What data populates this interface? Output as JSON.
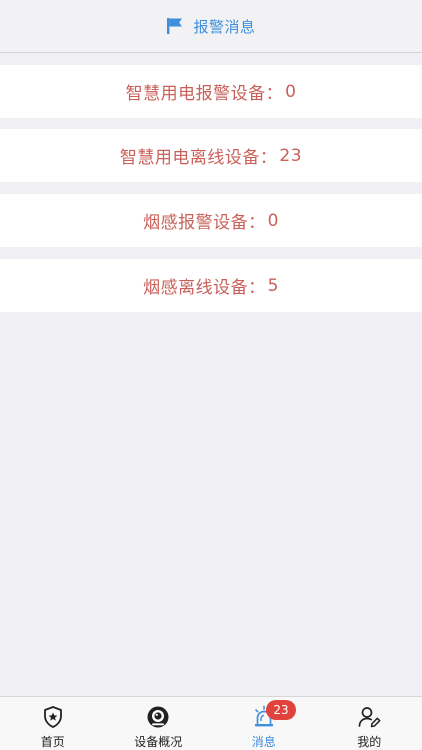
{
  "header": {
    "title": "报警消息",
    "icon": "flag-icon",
    "color": "#3f8fdc"
  },
  "cards": [
    {
      "label": "智慧用电报警设备：",
      "value": "0"
    },
    {
      "label": "智慧用电离线设备：",
      "value": "23"
    },
    {
      "label": "烟感报警设备：",
      "value": "0"
    },
    {
      "label": "烟感离线设备：",
      "value": "5"
    }
  ],
  "tabbar": {
    "tabs": [
      {
        "label": "首页",
        "icon": "shield-star-icon"
      },
      {
        "label": "设备概况",
        "icon": "camera-lens-icon"
      },
      {
        "label": "消息",
        "icon": "alarm-light-icon",
        "badge": "23",
        "active": true
      },
      {
        "label": "我的",
        "icon": "user-edit-icon"
      }
    ]
  },
  "colors": {
    "accent": "#3f8fdc",
    "card_text": "#c9605a",
    "badge": "#e0433c",
    "background": "#efeff4"
  }
}
